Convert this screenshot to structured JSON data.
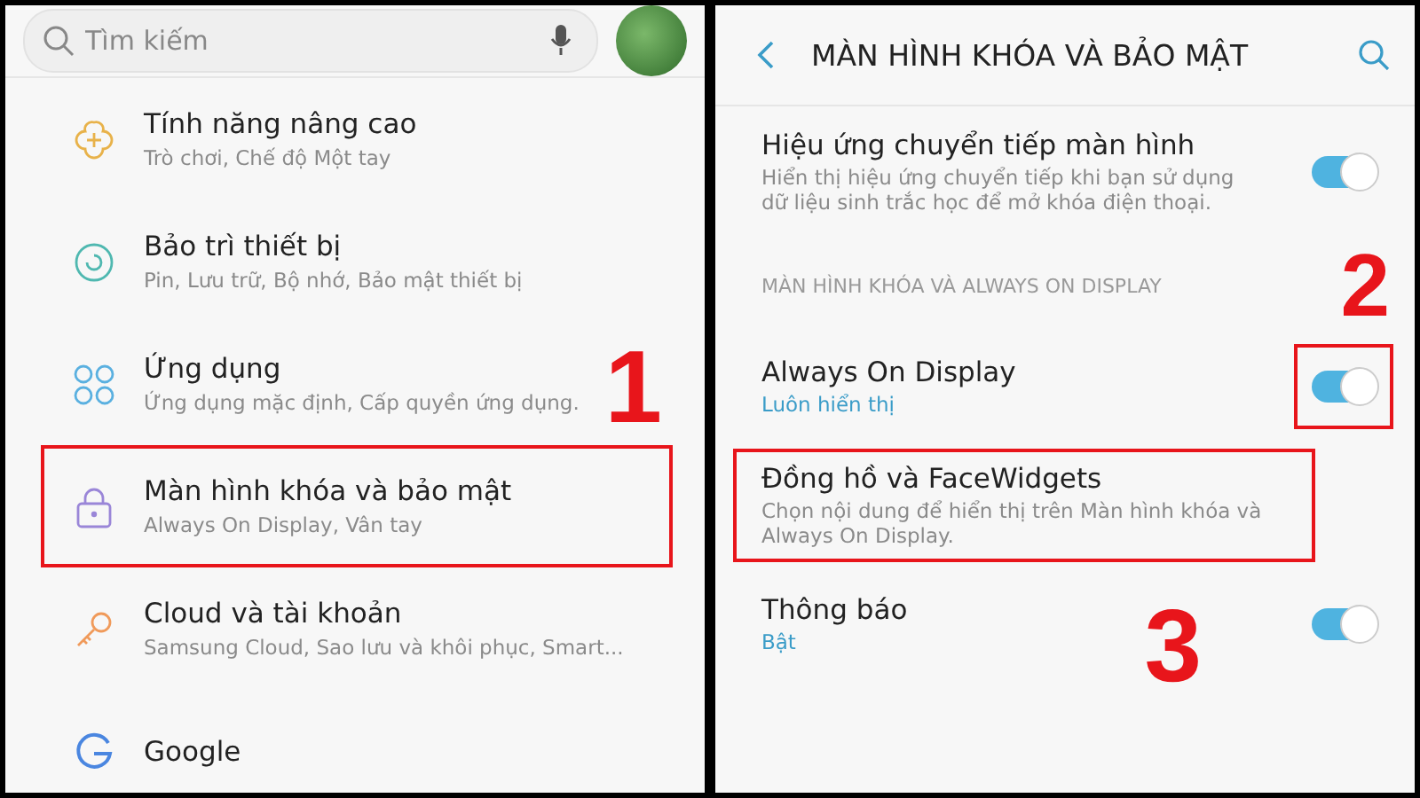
{
  "left_panel": {
    "search": {
      "placeholder": "Tìm kiếm"
    },
    "items": [
      {
        "title": "Tính năng nâng cao",
        "subtitle": "Trò chơi, Chế độ Một tay",
        "highlighted": false
      },
      {
        "title": "Bảo trì thiết bị",
        "subtitle": "Pin, Lưu trữ, Bộ nhớ, Bảo mật thiết bị",
        "highlighted": false
      },
      {
        "title": "Ứng dụng",
        "subtitle": "Ứng dụng mặc định, Cấp quyền ứng dụng.",
        "highlighted": false,
        "step": "1"
      },
      {
        "title": "Màn hình khóa và bảo mật",
        "subtitle": "Always On Display, Vân tay",
        "highlighted": true
      },
      {
        "title": "Cloud và tài khoản",
        "subtitle": "Samsung Cloud, Sao lưu và khôi phục, Smart...",
        "highlighted": false
      },
      {
        "title": "Google",
        "highlighted": false
      }
    ]
  },
  "right_panel": {
    "title": "MÀN HÌNH KHÓA VÀ BẢO MẬT",
    "items": [
      {
        "kind": "toggle",
        "title": "Hiệu ứng chuyển tiếp màn hình",
        "subtitle": "Hiển thị hiệu ứng chuyển tiếp khi bạn sử dụng dữ liệu sinh trắc học để mở khóa điện thoại.",
        "subtitle_is_value": false,
        "on": true,
        "highlighted": false
      },
      {
        "kind": "section",
        "title": "MÀN HÌNH KHÓA VÀ ALWAYS ON DISPLAY",
        "step": "2"
      },
      {
        "kind": "toggle",
        "title": "Always On Display",
        "subtitle": "Luôn hiển thị",
        "subtitle_is_value": true,
        "on": true,
        "highlighted": true
      },
      {
        "kind": "link",
        "title": "Đồng hồ và FaceWidgets",
        "subtitle": "Chọn nội dung để hiển thị trên Màn hình khóa và Always On Display.",
        "subtitle_is_value": false,
        "highlighted": true
      },
      {
        "kind": "toggle",
        "title": "Thông báo",
        "subtitle": "Bật",
        "subtitle_is_value": true,
        "on": true,
        "highlighted": false,
        "step": "3"
      }
    ]
  }
}
